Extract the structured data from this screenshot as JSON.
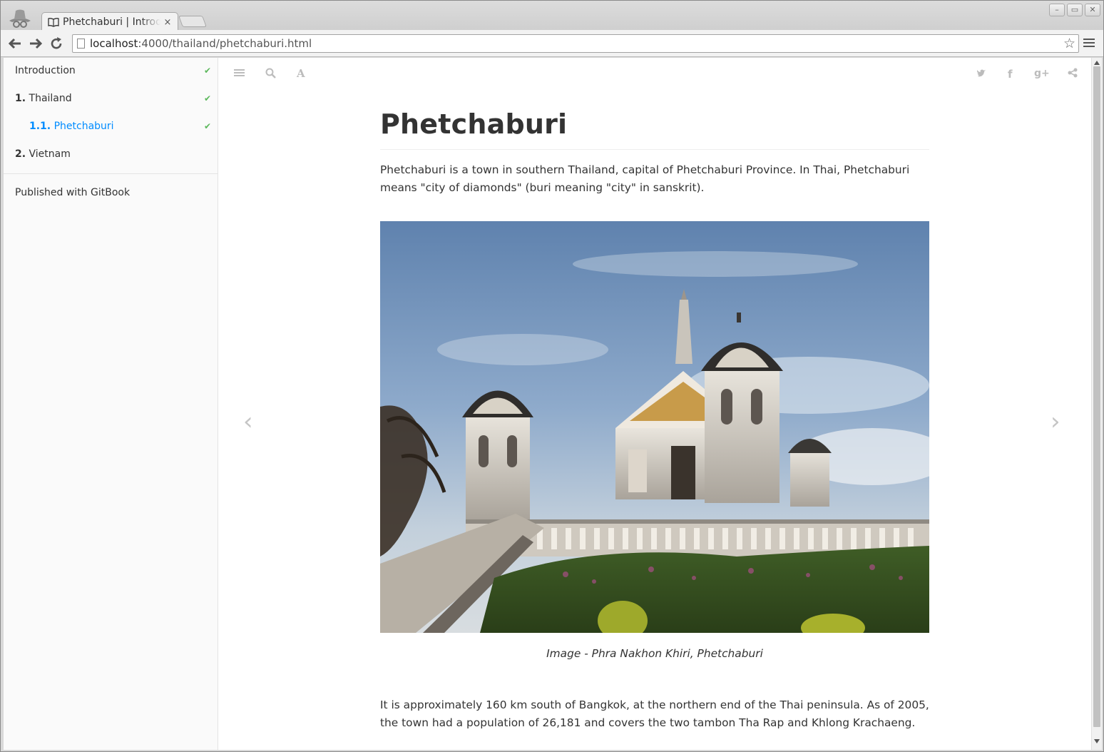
{
  "browser": {
    "tab_title": "Phetchaburi | Introduction",
    "tab_close": "×",
    "url_host": "localhost",
    "url_path": ":4000/thailand/phetchaburi.html"
  },
  "sidebar": {
    "items": [
      {
        "num": "",
        "label": "Introduction",
        "check": "✔"
      },
      {
        "num": "1.",
        "label": "Thailand",
        "check": "✔"
      },
      {
        "num": "1.1.",
        "label": "Phetchaburi",
        "check": "✔"
      },
      {
        "num": "2.",
        "label": "Vietnam",
        "check": ""
      }
    ],
    "published": "Published with GitBook"
  },
  "article": {
    "title": "Phetchaburi",
    "intro": "Phetchaburi is a town in southern Thailand, capital of Phetchaburi Province. In Thai, Phetchaburi means \"city of diamonds\" (buri meaning \"city\" in sanskrit).",
    "caption": "Image - Phra Nakhon Khiri, Phetchaburi",
    "body": "It is approximately 160 km south of Bangkok, at the northern end of the Thai peninsula. As of 2005, the town had a population of 26,181 and covers the two tambon Tha Rap and Khlong Krachaeng."
  },
  "icons": {
    "back": "back-arrow-icon",
    "forward": "forward-arrow-icon",
    "reload": "reload-icon",
    "bookmark": "star-icon",
    "menu": "hamburger-icon",
    "toc": "list-icon",
    "search": "search-icon",
    "font": "font-settings-icon",
    "twitter": "twitter-icon",
    "facebook": "facebook-icon",
    "googleplus": "google-plus-icon",
    "share": "share-icon"
  },
  "colors": {
    "active_link": "#008cff",
    "check": "#5cb85c",
    "text": "#333333"
  }
}
